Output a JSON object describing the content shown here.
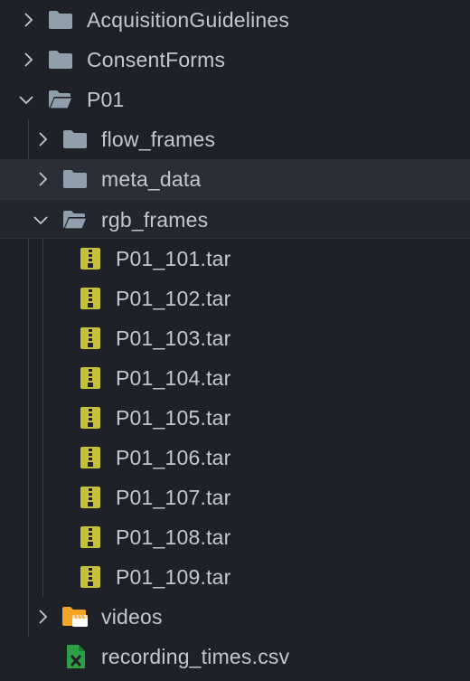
{
  "explorer": {
    "colors": {
      "background": "#1e2127",
      "folder": "#8fa0ac",
      "archive": "#c7c13a",
      "videos_folder": "#f5a524",
      "csv": "#2ea043",
      "text": "#c3c8d0"
    },
    "items": [
      {
        "label": "AcquisitionGuidelines",
        "type": "folder",
        "state": "collapsed",
        "depth": 0
      },
      {
        "label": "ConsentForms",
        "type": "folder",
        "state": "collapsed",
        "depth": 0
      },
      {
        "label": "P01",
        "type": "folder",
        "state": "expanded",
        "depth": 0
      },
      {
        "label": "flow_frames",
        "type": "folder",
        "state": "collapsed",
        "depth": 1
      },
      {
        "label": "meta_data",
        "type": "folder",
        "state": "collapsed",
        "depth": 1
      },
      {
        "label": "rgb_frames",
        "type": "folder",
        "state": "expanded",
        "depth": 1
      },
      {
        "label": "P01_101.tar",
        "type": "archive",
        "depth": 2
      },
      {
        "label": "P01_102.tar",
        "type": "archive",
        "depth": 2
      },
      {
        "label": "P01_103.tar",
        "type": "archive",
        "depth": 2
      },
      {
        "label": "P01_104.tar",
        "type": "archive",
        "depth": 2
      },
      {
        "label": "P01_105.tar",
        "type": "archive",
        "depth": 2
      },
      {
        "label": "P01_106.tar",
        "type": "archive",
        "depth": 2
      },
      {
        "label": "P01_107.tar",
        "type": "archive",
        "depth": 2
      },
      {
        "label": "P01_108.tar",
        "type": "archive",
        "depth": 2
      },
      {
        "label": "P01_109.tar",
        "type": "archive",
        "depth": 2
      },
      {
        "label": "videos",
        "type": "video-folder",
        "state": "collapsed",
        "depth": 1
      },
      {
        "label": "recording_times.csv",
        "type": "csv",
        "depth": 1
      }
    ]
  }
}
